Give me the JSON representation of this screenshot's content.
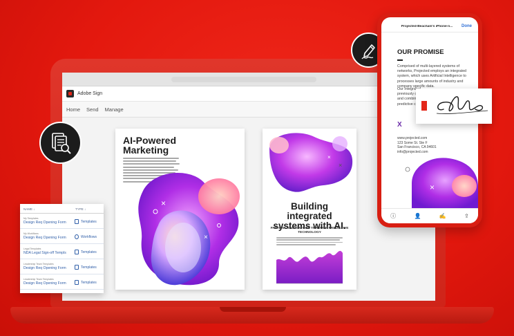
{
  "colors": {
    "brand_red": "#e32619",
    "dark_circle": "#1c1c1c",
    "link_blue": "#2f5ea8",
    "accent_purple": "#6a2aa8",
    "ios_blue": "#2f6fd6"
  },
  "app": {
    "title": "Adobe Sign",
    "nav": [
      "Home",
      "Send",
      "Manage"
    ]
  },
  "poster_left": {
    "title": "AI-Powered Marketing"
  },
  "poster_right": {
    "title": "Building integrated systems with AI.",
    "subtitle": "PATTERN RECOGNITION THROUGH PREDICTIVE TECHNOLOGY"
  },
  "list": {
    "headers": {
      "name": "NAME ↓",
      "type": "TYPE ↓"
    },
    "rows": [
      {
        "pre": "My Templates",
        "name": "Design Req Opening Form",
        "type": "Templates",
        "icon": "document-icon"
      },
      {
        "pre": "My Workflows",
        "name": "Design Req Opening Form",
        "type": "Workflows",
        "icon": "workflow-icon"
      },
      {
        "pre": "Legal Templates",
        "name": "NDA Legal Sign-off Templs",
        "type": "Templates",
        "icon": "document-icon"
      },
      {
        "pre": "Leadership Team Templates",
        "name": "Design Req Opening Form",
        "type": "Templates",
        "icon": "document-icon"
      },
      {
        "pre": "Leadership Team Templates",
        "name": "Design Req Opening Form",
        "type": "Templates",
        "icon": "document-icon"
      }
    ]
  },
  "phone": {
    "top_title": "Projected-Beacham's iPhone-n...",
    "done_label": "Done",
    "promise_title": "OUR PROMISE",
    "body": "Comprised of multi-layered systems of networks, Projected employs an integrated system, which uses Artificial Intelligence to processes large amounts of industry and company specific data.",
    "body2_lines": [
      "Our Integrated",
      "previously ch",
      "and combine",
      "predictive ca"
    ],
    "x_mark": "X",
    "address_lines": [
      "www.projected.com",
      "123 Some St. Ste F",
      "San Francisco, CA 94601",
      "info@projected.com"
    ],
    "tabs": [
      "info-icon",
      "person-icon",
      "sign-icon",
      "share-icon"
    ]
  },
  "icons": {
    "doc_circle": "document-search-icon",
    "sign_circle": "pen-signature-icon"
  }
}
